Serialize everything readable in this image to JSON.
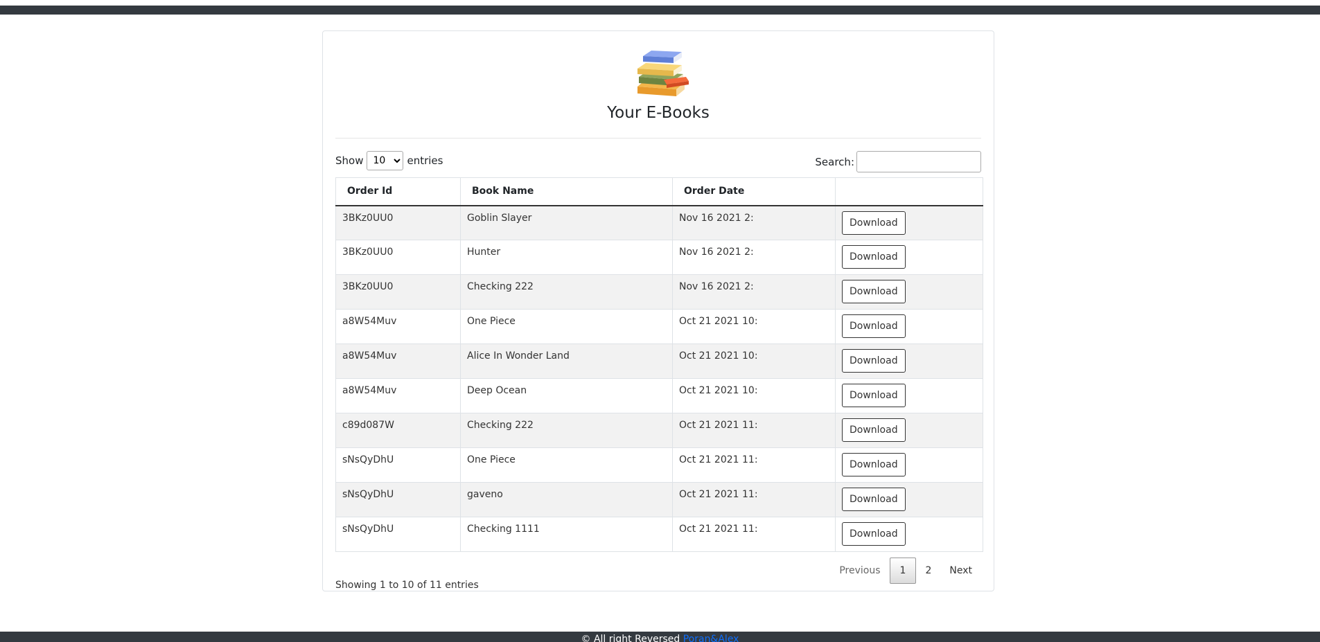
{
  "page": {
    "title": "Your E-Books"
  },
  "controls": {
    "show_label": "Show",
    "entries_label": "entries",
    "page_length": "10",
    "page_length_options": [
      "10"
    ],
    "search_label": "Search:",
    "search_value": ""
  },
  "table": {
    "headers": [
      "Order Id",
      "Book Name",
      "Order Date",
      ""
    ],
    "button_label": "Download",
    "rows": [
      {
        "order_id": "3BKz0UU0",
        "book_name": "Goblin Slayer",
        "order_date": "Nov 16 2021 2:"
      },
      {
        "order_id": "3BKz0UU0",
        "book_name": "Hunter",
        "order_date": "Nov 16 2021 2:"
      },
      {
        "order_id": "3BKz0UU0",
        "book_name": "Checking 222",
        "order_date": "Nov 16 2021 2:"
      },
      {
        "order_id": "a8W54Muv",
        "book_name": "One Piece",
        "order_date": "Oct 21 2021 10:"
      },
      {
        "order_id": "a8W54Muv",
        "book_name": "Alice In Wonder Land",
        "order_date": "Oct 21 2021 10:"
      },
      {
        "order_id": "a8W54Muv",
        "book_name": "Deep Ocean",
        "order_date": "Oct 21 2021 10:"
      },
      {
        "order_id": "c89d087W",
        "book_name": "Checking 222",
        "order_date": "Oct 21 2021 11:"
      },
      {
        "order_id": "sNsQyDhU",
        "book_name": "One Piece",
        "order_date": "Oct 21 2021 11:"
      },
      {
        "order_id": "sNsQyDhU",
        "book_name": "gaveno",
        "order_date": "Oct 21 2021 11:"
      },
      {
        "order_id": "sNsQyDhU",
        "book_name": "Checking 1111",
        "order_date": "Oct 21 2021 11:"
      }
    ]
  },
  "info": {
    "text": "Showing 1 to 10 of 11 entries"
  },
  "pagination": {
    "previous": "Previous",
    "pages": [
      "1",
      "2"
    ],
    "current": "1",
    "next": "Next"
  },
  "footer": {
    "text": "© All right Reversed",
    "link": "Poran&Alex"
  },
  "colors": {
    "nav_bg": "#343a40",
    "link": "#0d6efd",
    "stripe": "#f2f2f2"
  },
  "icons": {
    "logo": "books-stack-icon"
  }
}
